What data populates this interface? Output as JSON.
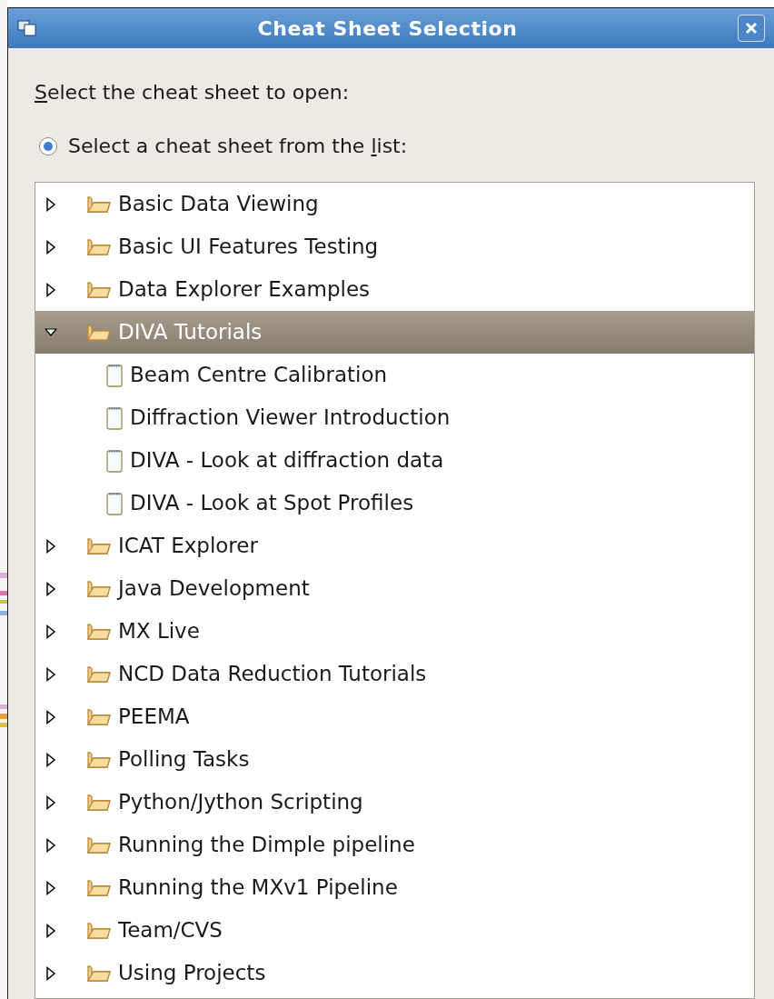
{
  "window": {
    "title": "Cheat Sheet Selection"
  },
  "prompt": {
    "mnemonic": "S",
    "text_after": "elect the cheat sheet to open:"
  },
  "options": [
    {
      "text_before": "Select a cheat sheet from the ",
      "mnemonic": "l",
      "text_after": "ist:",
      "selected": true
    }
  ],
  "tree": [
    {
      "label": "Basic Data Viewing",
      "kind": "folder",
      "expanded": false,
      "selected": false
    },
    {
      "label": "Basic UI Features Testing",
      "kind": "folder",
      "expanded": false,
      "selected": false
    },
    {
      "label": "Data Explorer Examples",
      "kind": "folder",
      "expanded": false,
      "selected": false
    },
    {
      "label": "DIVA Tutorials",
      "kind": "folder",
      "expanded": true,
      "selected": true,
      "children": [
        {
          "label": "Beam Centre Calibration",
          "kind": "sheet",
          "selected": false
        },
        {
          "label": "Diffraction Viewer Introduction",
          "kind": "sheet",
          "selected": false
        },
        {
          "label": "DIVA - Look at diffraction data",
          "kind": "sheet",
          "selected": false
        },
        {
          "label": "DIVA - Look at Spot Profiles",
          "kind": "sheet",
          "selected": false
        }
      ]
    },
    {
      "label": "ICAT Explorer",
      "kind": "folder",
      "expanded": false,
      "selected": false
    },
    {
      "label": "Java Development",
      "kind": "folder",
      "expanded": false,
      "selected": false
    },
    {
      "label": "MX Live",
      "kind": "folder",
      "expanded": false,
      "selected": false
    },
    {
      "label": "NCD Data Reduction Tutorials",
      "kind": "folder",
      "expanded": false,
      "selected": false
    },
    {
      "label": "PEEMA",
      "kind": "folder",
      "expanded": false,
      "selected": false
    },
    {
      "label": "Polling Tasks",
      "kind": "folder",
      "expanded": false,
      "selected": false
    },
    {
      "label": "Python/Jython Scripting",
      "kind": "folder",
      "expanded": false,
      "selected": false
    },
    {
      "label": "Running the Dimple pipeline",
      "kind": "folder",
      "expanded": false,
      "selected": false
    },
    {
      "label": "Running the MXv1 Pipeline",
      "kind": "folder",
      "expanded": false,
      "selected": false
    },
    {
      "label": "Team/CVS",
      "kind": "folder",
      "expanded": false,
      "selected": false
    },
    {
      "label": "Using Projects",
      "kind": "folder",
      "expanded": false,
      "selected": false
    }
  ]
}
